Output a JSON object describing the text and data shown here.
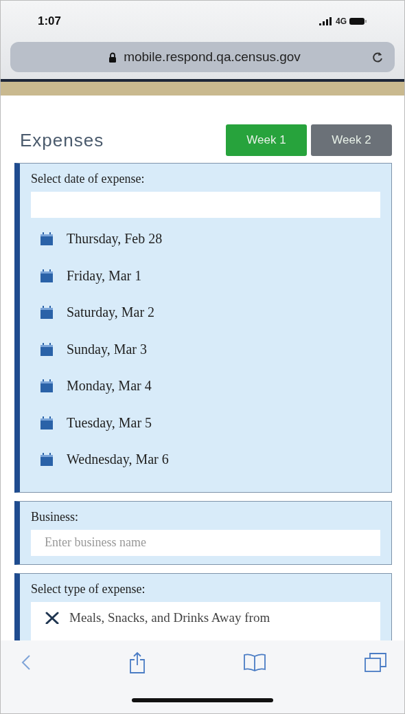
{
  "status_bar": {
    "time": "1:07",
    "network": "4G"
  },
  "address_bar": {
    "url": "mobile.respond.qa.census.gov"
  },
  "page": {
    "title": "Expenses",
    "week_tabs": [
      {
        "label": "Week 1",
        "selected": true
      },
      {
        "label": "Week 2",
        "selected": false
      }
    ],
    "date_section": {
      "label": "Select date of expense:",
      "dates": [
        "Thursday, Feb 28",
        "Friday, Mar 1",
        "Saturday, Mar 2",
        "Sunday, Mar 3",
        "Monday, Mar 4",
        "Tuesday, Mar 5",
        "Wednesday, Mar 6"
      ]
    },
    "business_section": {
      "label": "Business:",
      "placeholder": "Enter business name"
    },
    "type_section": {
      "label": "Select type of expense:",
      "options": [
        "Meals, Snacks, and Drinks Away from"
      ]
    }
  }
}
